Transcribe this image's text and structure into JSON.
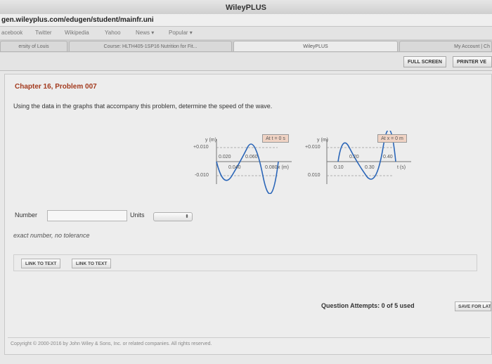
{
  "browser": {
    "title": "WileyPLUS",
    "url": "gen.wileyplus.com/edugen/student/mainfr.uni",
    "bookmarks": [
      "acebook",
      "Twitter",
      "Wikipedia",
      "Yahoo",
      "News ▾",
      "Popular ▾"
    ],
    "tabs": [
      {
        "label": "ersity of Louis"
      },
      {
        "label": "Course: HLTH405-1SP16 Nutrition for Fit..."
      },
      {
        "label": "WileyPLUS"
      },
      {
        "label": "My Account | Ch"
      }
    ]
  },
  "toolbar": {
    "full_screen": "FULL SCREEN",
    "printer": "PRINTER VE"
  },
  "problem": {
    "chapter": "Chapter 16, Problem 007",
    "question": "Using the data in the graphs that accompany this problem, determine the speed of the wave."
  },
  "graph1": {
    "y_label": "y (m)",
    "y_pos": "+0.010",
    "y_neg": "-0.010",
    "condition": "At t = 0 s",
    "tick_labels": [
      "0.020",
      "0.040",
      "0.060",
      "0.080"
    ],
    "x_label": "x (m)"
  },
  "graph2": {
    "y_label": "y (m)",
    "y_pos": "+0.010",
    "y_neg": "0.010",
    "condition": "At x = 0 m",
    "tick_labels": [
      "0.10",
      "0.20",
      "0.30",
      "0.40"
    ],
    "x_label": "t (s)"
  },
  "answer": {
    "number_label": "Number",
    "number_value": "",
    "units_label": "Units",
    "units_value": "",
    "tolerance": "exact number, no tolerance"
  },
  "links": {
    "link1": "LINK TO TEXT",
    "link2": "LINK TO TEXT"
  },
  "attempts": {
    "text": "Question Attempts: 0 of 5 used",
    "save": "SAVE FOR LAT"
  },
  "footer": {
    "copyright": "Copyright © 2000-2016 by John Wiley & Sons, Inc. or related companies. All rights reserved."
  },
  "colors": {
    "chapter": "#a33a1e",
    "wave": "#2b66b8"
  }
}
